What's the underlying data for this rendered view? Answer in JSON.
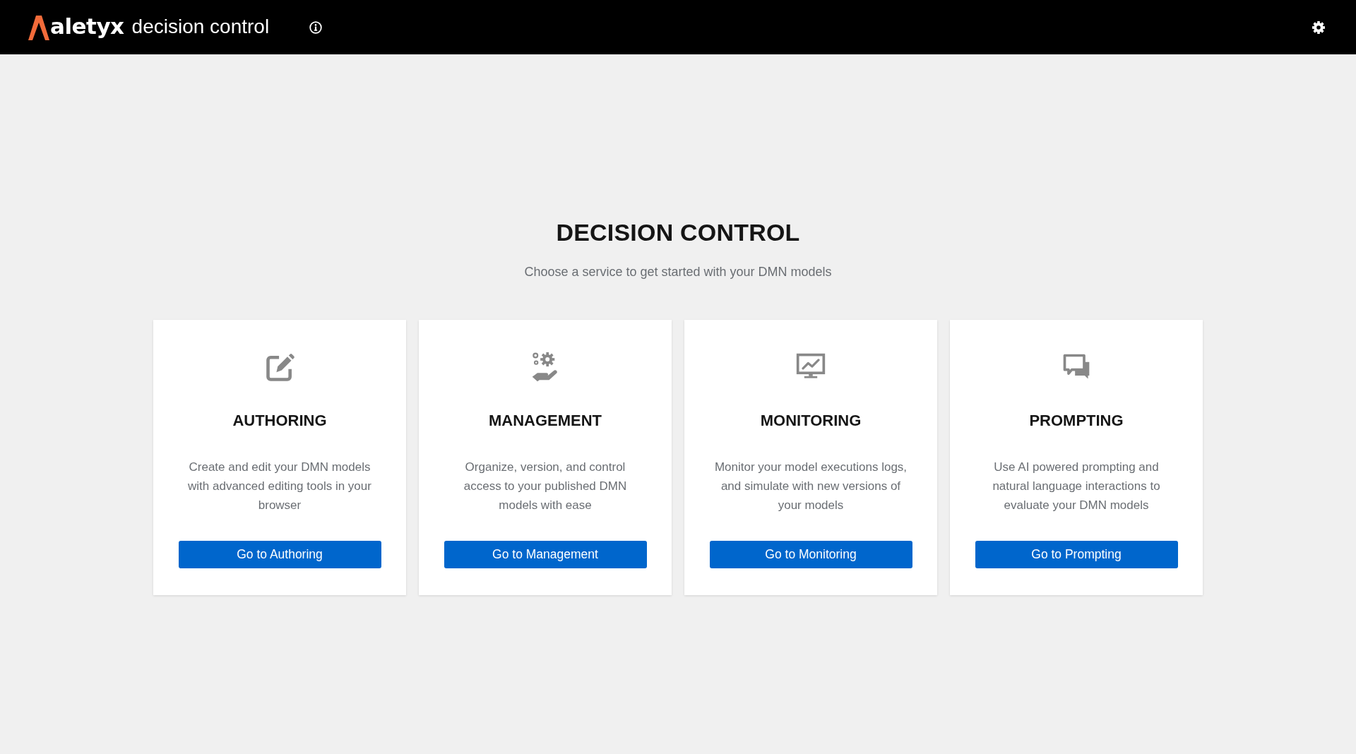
{
  "header": {
    "brand": "aletyx",
    "product": "decision control"
  },
  "page": {
    "title": "DECISION CONTROL",
    "subtitle": "Choose a service to get started with your DMN models"
  },
  "services": [
    {
      "kind": "authoring",
      "title": "AUTHORING",
      "description": "Create and edit your DMN models with advanced editing tools in your browser",
      "button": "Go to Authoring"
    },
    {
      "kind": "management",
      "title": "MANAGEMENT",
      "description": "Organize, version, and control access to your published DMN models with ease",
      "button": "Go to Management"
    },
    {
      "kind": "monitoring",
      "title": "MONITORING",
      "description": "Monitor your model executions logs, and simulate with new versions of your models",
      "button": "Go to Monitoring"
    },
    {
      "kind": "prompting",
      "title": "PROMPTING",
      "description": "Use AI powered prompting and natural language interactions to evaluate your DMN models",
      "button": "Go to Prompting"
    }
  ]
}
